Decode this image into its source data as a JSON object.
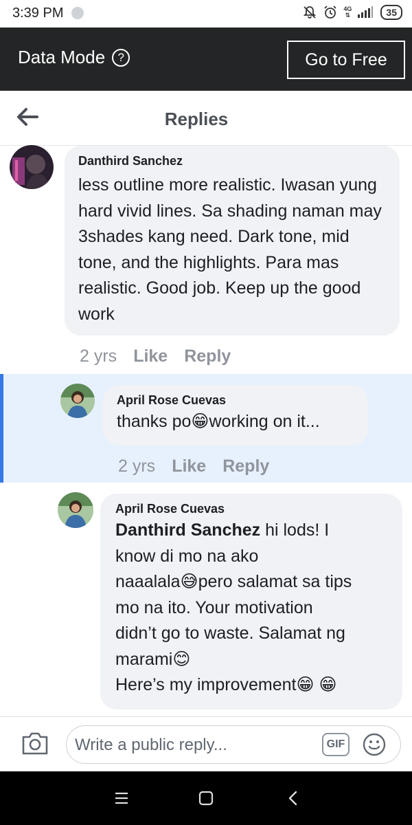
{
  "status_bar": {
    "time": "3:39 PM",
    "network": "4G",
    "battery": "35"
  },
  "data_bar": {
    "title": "Data Mode",
    "help_icon": "?",
    "button_label": "Go to Free"
  },
  "header": {
    "title": "Replies"
  },
  "comments": [
    {
      "author": "Danthird Sanchez",
      "text": "less outline more realistic. Iwasan yung hard vivid lines. Sa shading naman may 3shades kang need. Dark tone, mid tone, and the highlights. Para mas realistic. Good job. Keep up the good work",
      "time": "2 yrs",
      "like": "Like",
      "reply": "Reply"
    },
    {
      "author": "April Rose Cuevas",
      "text_before": "thanks po",
      "emoji": "😁",
      "text_after": "working on it...",
      "time": "2 yrs",
      "like": "Like",
      "reply": "Reply"
    },
    {
      "author": "April Rose Cuevas",
      "mention": "Danthird Sanchez",
      "line1": " hi lods! I",
      "line2": "know di mo na ako",
      "line3a": "naaalala",
      "emoji_sweat": "😅",
      "line3b": "pero salamat sa tips",
      "line4": "mo na ito. Your motivation",
      "line5": "didn’t go to waste. Salamat ng",
      "line6": "marami",
      "emoji_smile": "😊",
      "line7": "Here’s my improvement",
      "emoji_grin": "😁"
    }
  ],
  "composer": {
    "placeholder": "Write a public reply...",
    "gif_label": "GIF"
  },
  "colors": {
    "accent": "#3578e5",
    "dark_bar": "#242526",
    "bubble": "#f0f2f5",
    "meta": "#90949c"
  }
}
